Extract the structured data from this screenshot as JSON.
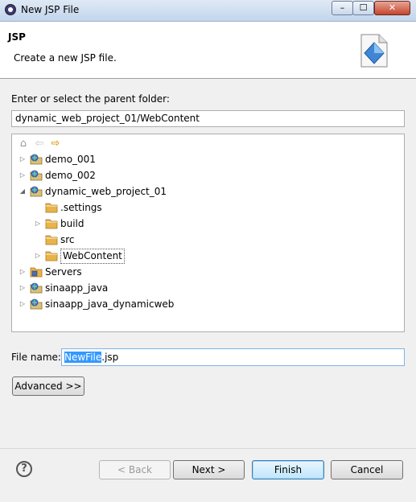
{
  "window": {
    "title": "New JSP File",
    "minimize": "–",
    "maximize": "☐",
    "close": "✕"
  },
  "banner": {
    "title": "JSP",
    "description": "Create a new JSP file."
  },
  "parent_folder": {
    "label": "Enter or select the parent folder:",
    "value": "dynamic_web_project_01/WebContent"
  },
  "tree_nav": {
    "home": "⌂",
    "back": "⇦",
    "forward": "⇨"
  },
  "tree": [
    {
      "label": "demo_001",
      "type": "project",
      "expanded": false
    },
    {
      "label": "demo_002",
      "type": "project",
      "expanded": false
    },
    {
      "label": "dynamic_web_project_01",
      "type": "project",
      "expanded": true
    },
    {
      "label": ".settings",
      "type": "folder",
      "expanded": null
    },
    {
      "label": "build",
      "type": "folder",
      "expanded": false
    },
    {
      "label": "src",
      "type": "folder",
      "expanded": null
    },
    {
      "label": "WebContent",
      "type": "folder",
      "expanded": false,
      "selected": true
    },
    {
      "label": "Servers",
      "type": "servers",
      "expanded": false
    },
    {
      "label": "sinaapp_java",
      "type": "project",
      "expanded": false
    },
    {
      "label": "sinaapp_java_dynamicweb",
      "type": "project",
      "expanded": false
    }
  ],
  "file_name": {
    "label": "File name:",
    "selected_part": "NewFile",
    "rest": ".jsp"
  },
  "buttons": {
    "advanced": "Advanced >>",
    "back": "< Back",
    "next": "Next >",
    "finish": "Finish",
    "cancel": "Cancel",
    "help": "?"
  },
  "colors": {
    "selection": "#3399ff",
    "folder": "#e8b34a",
    "project": "#3b7dd8"
  }
}
